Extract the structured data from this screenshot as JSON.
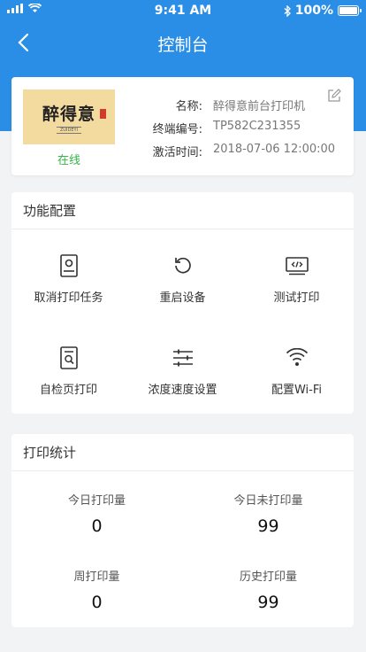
{
  "status_bar": {
    "time": "9:41 AM",
    "battery": "100%"
  },
  "nav": {
    "title": "控制台"
  },
  "device": {
    "logo_text": "醉得意",
    "logo_subtext": "ZUIDEYI",
    "status": "在线",
    "fields": [
      {
        "label": "名称:",
        "value": "醉得意前台打印机"
      },
      {
        "label": "终端编号:",
        "value": "TP582C231355"
      },
      {
        "label": "激活时间:",
        "value": "2018-07-06  12:00:00"
      }
    ]
  },
  "functions": {
    "title": "功能配置",
    "items": [
      {
        "label": "取消打印任务",
        "icon": "document-cancel-icon"
      },
      {
        "label": "重启设备",
        "icon": "refresh-icon"
      },
      {
        "label": "测试打印",
        "icon": "code-test-icon"
      },
      {
        "label": "自检页打印",
        "icon": "document-search-icon"
      },
      {
        "label": "浓度速度设置",
        "icon": "sliders-icon"
      },
      {
        "label": "配置Wi-Fi",
        "icon": "wifi-icon"
      }
    ]
  },
  "stats": {
    "title": "打印统计",
    "items": [
      {
        "label": "今日打印量",
        "value": "0"
      },
      {
        "label": "今日未打印量",
        "value": "99"
      },
      {
        "label": "周打印量",
        "value": "0"
      },
      {
        "label": "历史打印量",
        "value": "99"
      }
    ]
  }
}
